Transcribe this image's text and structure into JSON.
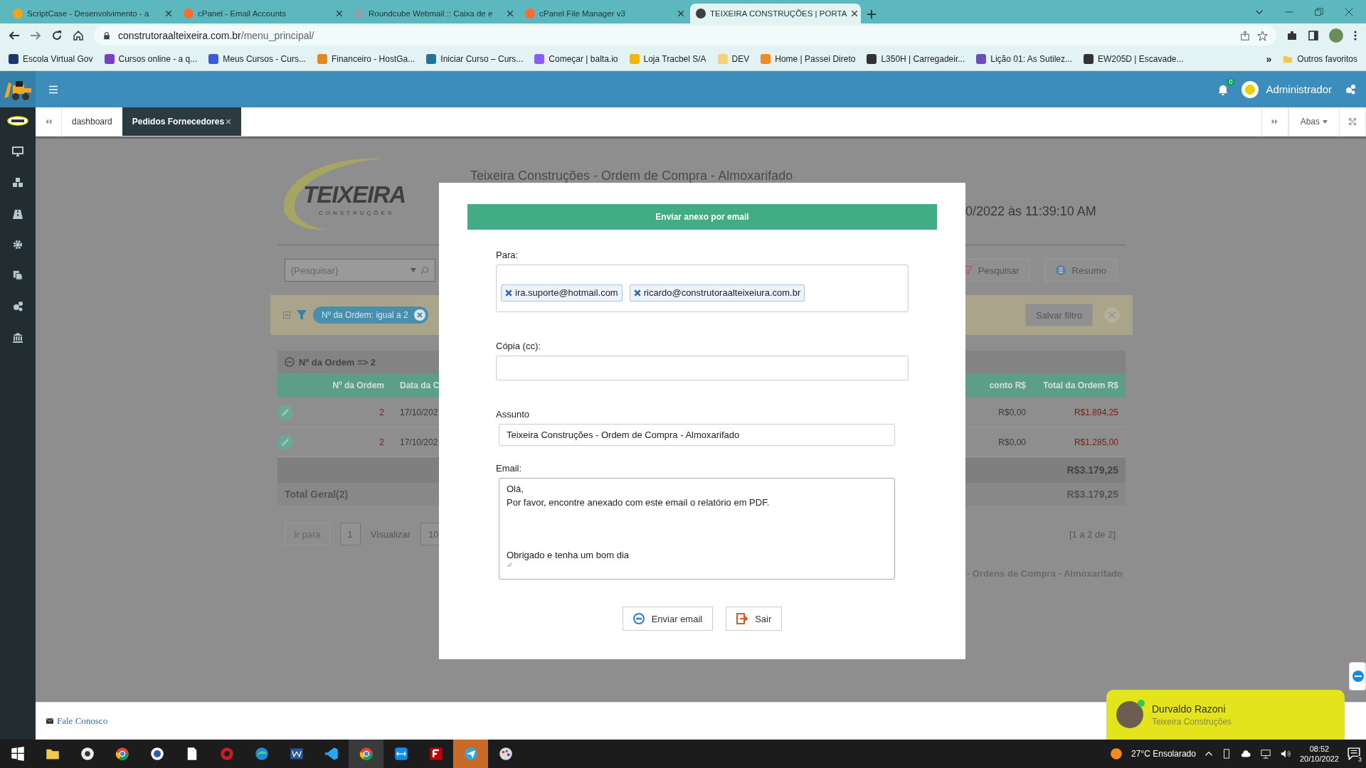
{
  "browser": {
    "tabs": [
      {
        "title": "ScriptCase - Desenvolvimento - a",
        "selected": false,
        "color": "#f2a51c"
      },
      {
        "title": "cPanel - Email Accounts",
        "selected": false,
        "color": "#ff6c2c"
      },
      {
        "title": "Roundcube Webmail :: Caixa de e",
        "selected": false,
        "color": "#8da0b0"
      },
      {
        "title": "cPanel File Manager v3",
        "selected": false,
        "color": "#ff6c2c"
      },
      {
        "title": "TEIXEIRA CONSTRUÇÕES | PORTA",
        "selected": true,
        "color": "#3c4043"
      }
    ],
    "url_domain": "construtoraalteixeira.com.br",
    "url_path": "/menu_principal/",
    "bookmarks": [
      {
        "label": "Escola Virtual Gov",
        "color": "#1b3a6b"
      },
      {
        "label": "Cursos online - a q...",
        "color": "#7a3fc4"
      },
      {
        "label": "Meus Cursos - Curs...",
        "color": "#3b5bdb"
      },
      {
        "label": "Financeiro - HostGa...",
        "color": "#e08a1e"
      },
      {
        "label": "Iniciar Curso – Curs...",
        "color": "#21759b"
      },
      {
        "label": "Começar | balta.io",
        "color": "#8b5cf6"
      },
      {
        "label": "Loja Tracbel S/A",
        "color": "#f5b400"
      },
      {
        "label": "DEV",
        "color": "#f2d27a"
      },
      {
        "label": "Home | Passei Direto",
        "color": "#f08a24"
      },
      {
        "label": "L350H | Carregadeir...",
        "color": "#333333"
      },
      {
        "label": "Lição 01: As Sutilez...",
        "color": "#6b4fbb"
      },
      {
        "label": "EW205D | Escavade...",
        "color": "#333333"
      }
    ],
    "bookmarks_more": "»",
    "other_bookmarks": "Outros favoritos"
  },
  "app_header": {
    "notifications": "0",
    "user": "Administrador"
  },
  "app_tabs": [
    {
      "label": "dashboard",
      "selected": false
    },
    {
      "label": "Pedidos Fornecedores",
      "selected": true
    }
  ],
  "tabs_menu": "Abas",
  "page": {
    "logo_text": "TEIXEIRA",
    "logo_subtext": "CONSTRUÇÕES",
    "title": "Teixeira Construções - Ordem de Compra - Almoxarifado",
    "date": "0/2022 às 11:39:10 AM",
    "search_placeholder": "{Pesquisar}",
    "search_button": "Pesquisar",
    "summary_button": "Resumo",
    "filter_chip": "Nº da Ordem: igual a 2",
    "save_filter": "Salvar filtro",
    "group_label": "Nº da Ordem => 2",
    "columns": [
      "Nº da Ordem",
      "Data da C",
      "conto R$",
      "Total da Ordem R$"
    ],
    "rows": [
      [
        "2",
        "17/10/202",
        "R$0,00",
        "R$1.894,25"
      ],
      [
        "2",
        "17/10/202",
        "R$0,00",
        "R$1.285,00"
      ]
    ],
    "subtotal": "R$3.179,25",
    "total_label": "Total Geral(2)",
    "total": "R$3.179,25",
    "pager": {
      "goto_label": "Ir para",
      "page": "1",
      "view_label": "Visualizar",
      "page_size": "10",
      "range": "[1 a 2 de 2]"
    },
    "footer_title": "- Ordens de Compra - Almoxarifado"
  },
  "modal": {
    "title": "Enviar anexo por email",
    "to_label": "Para:",
    "to": [
      "ira.suporte@hotmail.com",
      "ricardo@construtoraalteixeiura.com.br"
    ],
    "cc_label": "Cópia (cc):",
    "subject_label": "Assunto",
    "subject": "Teixeira Construções - Ordem de Compra - Almoxarifado",
    "body_label": "Email:",
    "body": "Olá,\nPor favor, encontre anexado com este email o relatório em PDF.\n\n\n\nObrigado e tenha um bom dia",
    "buttons": [
      {
        "label": "Enviar email",
        "kind": "send"
      },
      {
        "label": "Sair",
        "kind": "exit"
      }
    ]
  },
  "footer": {
    "contact_link": "Fale Conosco"
  },
  "chat": {
    "name": "Durvaldo Razoni",
    "company": "Teixeira Construções"
  },
  "taskbar": {
    "weather": "27°C  Ensolarado",
    "time": "08:52",
    "date": "20/10/2022",
    "notifications": "3"
  }
}
